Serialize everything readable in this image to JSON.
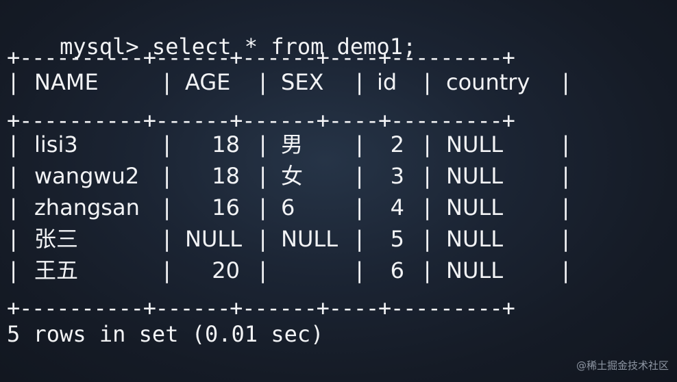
{
  "terminal": {
    "prompt": "mysql>",
    "command": " select * from demo1;",
    "border": "+----------+------+------+----+---------+",
    "columns": [
      "NAME",
      "AGE",
      "SEX",
      "id",
      "country"
    ],
    "rows": [
      {
        "name": "lisi3",
        "age": "18",
        "sex": "男",
        "id": "2",
        "country": "NULL"
      },
      {
        "name": "wangwu2",
        "age": "18",
        "sex": "女",
        "id": "3",
        "country": "NULL"
      },
      {
        "name": "zhangsan",
        "age": "16",
        "sex": "6",
        "id": "4",
        "country": "NULL"
      },
      {
        "name": "张三",
        "age": "NULL",
        "sex": "NULL",
        "id": "5",
        "country": "NULL"
      },
      {
        "name": "王五",
        "age": "20",
        "sex": "",
        "id": "6",
        "country": "NULL"
      }
    ],
    "summary": "5 rows in set (0.01 sec)"
  },
  "watermark": "@稀土掘金技术社区",
  "colors": {
    "text": "#f2f3f5",
    "background": "#1b2433"
  }
}
